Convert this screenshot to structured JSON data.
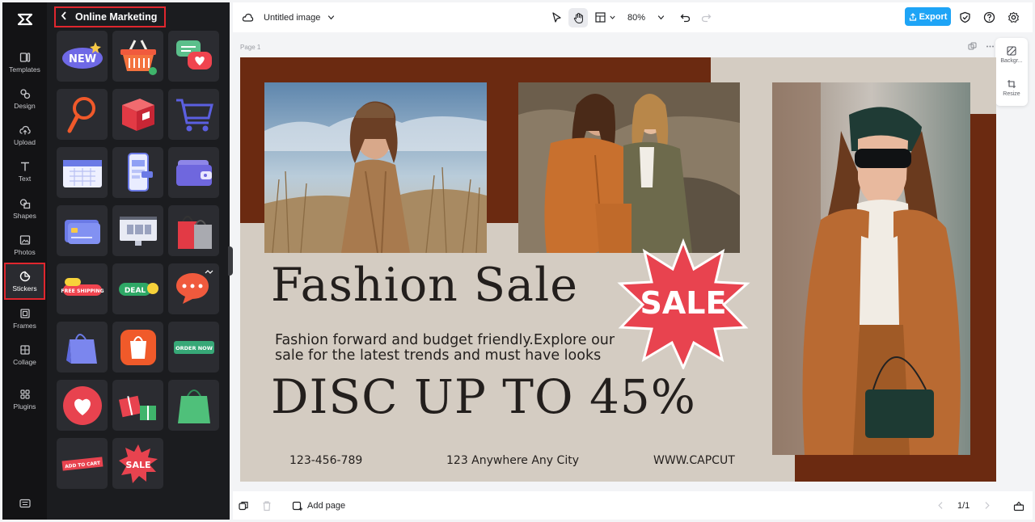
{
  "rail": {
    "items": [
      {
        "label": "Templates",
        "icon": "templates-icon"
      },
      {
        "label": "Design",
        "icon": "design-icon"
      },
      {
        "label": "Upload",
        "icon": "upload-icon"
      },
      {
        "label": "Text",
        "icon": "text-icon"
      },
      {
        "label": "Shapes",
        "icon": "shapes-icon"
      },
      {
        "label": "Photos",
        "icon": "photos-icon"
      },
      {
        "label": "Stickers",
        "icon": "stickers-icon",
        "active": true
      },
      {
        "label": "Frames",
        "icon": "frames-icon"
      },
      {
        "label": "Collage",
        "icon": "collage-icon"
      },
      {
        "label": "Plugins",
        "icon": "plugins-icon"
      }
    ]
  },
  "panel": {
    "title": "Online Marketing",
    "stickers": [
      "NEW",
      "shopping-basket",
      "chat-heart",
      "magnifier",
      "package-box",
      "shopping-cart",
      "calendar",
      "mobile-shop",
      "wallet",
      "credit-card",
      "monitor",
      "shopping-bags",
      "FREE SHIPPING",
      "DEAL",
      "chat-bubble",
      "shopping-bag",
      "shop-app",
      "ORDER NOW",
      "heart",
      "gift-boxes",
      "green-bag",
      "ADD TO CART",
      "SALE"
    ]
  },
  "topbar": {
    "doc_title": "Untitled image",
    "zoom": "80%",
    "export_label": "Export"
  },
  "canvas": {
    "page_label": "Page 1",
    "right_panel": {
      "background_label": "Backgr...",
      "resize_label": "Resize"
    }
  },
  "design": {
    "title": "Fashion Sale",
    "subtitle": "Fashion forward and budget friendly.Explore our sale for the latest trends and must have looks",
    "discount": "DISC UP TO 45%",
    "badge": "SALE",
    "phone": "123-456-789",
    "address": "123 Anywhere Any City",
    "website": "WWW.CAPCUT"
  },
  "bottombar": {
    "add_page_label": "Add page",
    "page_counter": "1/1"
  },
  "colors": {
    "accent": "#1ea4f6",
    "highlight_border": "#e0262e",
    "design_bg": "#d4ccc2",
    "design_brown": "#6b2a11",
    "sale_red": "#e8434f"
  }
}
